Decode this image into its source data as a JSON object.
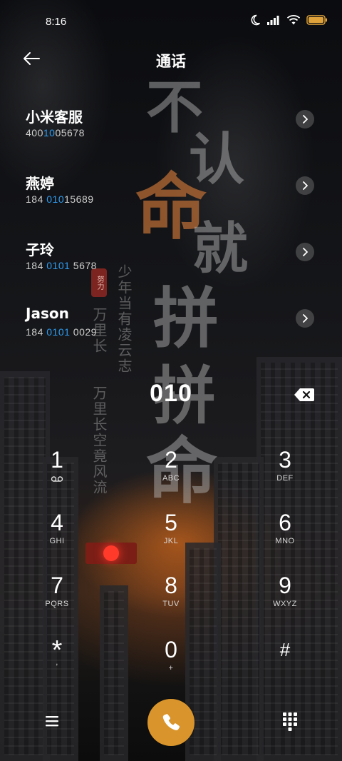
{
  "status_bar": {
    "time": "8:16",
    "icons": [
      "moon-icon",
      "signal-icon",
      "wifi-icon",
      "battery-icon"
    ],
    "battery_color": "#e0a33b"
  },
  "header": {
    "title": "通话",
    "back_icon": "back-arrow-icon"
  },
  "contacts": [
    {
      "name": "小米客服",
      "number_parts": [
        "400",
        "1005678"
      ],
      "highlight": "10",
      "display": [
        "400",
        "10",
        "05678"
      ]
    },
    {
      "name": "燕婷",
      "display": [
        "184 ",
        "010",
        "15689"
      ]
    },
    {
      "name": "子玲",
      "display": [
        "184 ",
        "0101",
        " 5678"
      ]
    },
    {
      "name": "Jason",
      "display": [
        "184 ",
        "0101",
        " 0029"
      ]
    }
  ],
  "dial": {
    "input_value": "010",
    "backspace_icon": "backspace-icon",
    "keys": [
      {
        "digit": "1",
        "letters": "",
        "sub_icon": "voicemail-icon"
      },
      {
        "digit": "2",
        "letters": "ABC"
      },
      {
        "digit": "3",
        "letters": "DEF"
      },
      {
        "digit": "4",
        "letters": "GHI"
      },
      {
        "digit": "5",
        "letters": "JKL"
      },
      {
        "digit": "6",
        "letters": "MNO"
      },
      {
        "digit": "7",
        "letters": "PQRS"
      },
      {
        "digit": "8",
        "letters": "TUV"
      },
      {
        "digit": "9",
        "letters": "WXYZ"
      },
      {
        "digit": "*",
        "letters": ","
      },
      {
        "digit": "0",
        "letters": "+"
      },
      {
        "digit": "#",
        "letters": ""
      }
    ]
  },
  "bottom_bar": {
    "menu_icon": "menu-icon",
    "call_icon": "phone-icon",
    "call_color": "#d9952b",
    "dialpad_icon": "dialpad-icon"
  },
  "wallpaper": {
    "calligraphy": [
      "不",
      "认",
      "命",
      "就",
      "拼"
    ],
    "poem_1": "少年当有凌云志",
    "poem_2": "万里长空竟风流",
    "poem_3": "万里长",
    "seal": "努力"
  }
}
